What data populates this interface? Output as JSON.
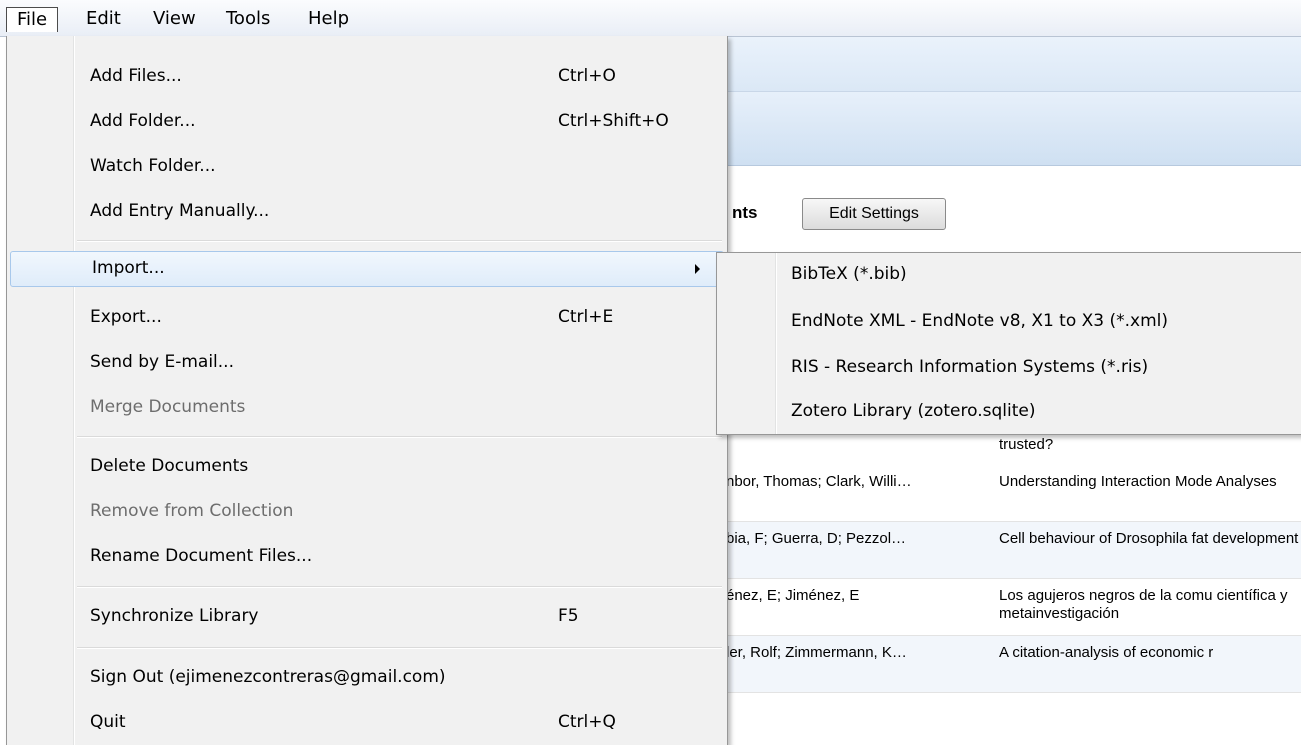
{
  "menubar": {
    "items": [
      {
        "label": "File"
      },
      {
        "label": "Edit"
      },
      {
        "label": "View"
      },
      {
        "label": "Tools"
      },
      {
        "label": "Help"
      }
    ]
  },
  "background": {
    "heading_partial": "nts",
    "edit_settings_label": "Edit Settings",
    "trusted_text": "trusted?",
    "rows": [
      {
        "authors": "nbor, Thomas; Clark, Willi…",
        "title": "Understanding Interaction Mode Analyses"
      },
      {
        "authors": "bia, F; Guerra, D; Pezzol…",
        "title": "Cell behaviour of Drosophila fat development"
      },
      {
        "authors": "énez, E; Jiménez, E",
        "title": "Los agujeros negros de la comu científica y metainvestigación"
      },
      {
        "authors": "ler, Rolf; Zimmermann, K…",
        "title": "A citation-analysis of economic r"
      }
    ]
  },
  "file_menu": {
    "items": [
      {
        "label": "Add Files...",
        "shortcut": "Ctrl+O"
      },
      {
        "label": "Add Folder...",
        "shortcut": "Ctrl+Shift+O"
      },
      {
        "label": "Watch Folder...",
        "shortcut": ""
      },
      {
        "label": "Add Entry Manually...",
        "shortcut": ""
      },
      {
        "label": "Import...",
        "shortcut": ""
      },
      {
        "label": "Export...",
        "shortcut": "Ctrl+E"
      },
      {
        "label": "Send by E-mail...",
        "shortcut": ""
      },
      {
        "label": "Merge Documents",
        "shortcut": ""
      },
      {
        "label": "Delete Documents",
        "shortcut": ""
      },
      {
        "label": "Remove from Collection",
        "shortcut": ""
      },
      {
        "label": "Rename Document Files...",
        "shortcut": ""
      },
      {
        "label": "Synchronize Library",
        "shortcut": "F5"
      },
      {
        "label": "Sign Out (ejimenezcontreras@gmail.com)",
        "shortcut": ""
      },
      {
        "label": "Quit",
        "shortcut": "Ctrl+Q"
      }
    ]
  },
  "import_submenu": {
    "items": [
      {
        "label": "BibTeX (*.bib)"
      },
      {
        "label": "EndNote XML - EndNote v8, X1 to X3 (*.xml)"
      },
      {
        "label": "RIS - Research Information Systems (*.ris)"
      },
      {
        "label": "Zotero Library (zotero.sqlite)"
      }
    ]
  }
}
